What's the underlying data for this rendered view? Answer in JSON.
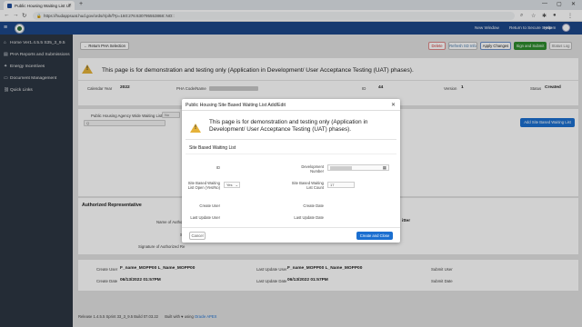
{
  "browser": {
    "tab_title": "Public Housing Waiting List Ut",
    "new_tab": "+",
    "url": "https://hudappsuat.hud.gov/ords/r/pih/f?p=160:276:630795553868::NO::",
    "min": "—",
    "max": "▢",
    "close": "✕"
  },
  "header": {
    "links": {
      "new_window": "New Window",
      "return": "Return to Secure System",
      "help": "Help"
    }
  },
  "sidebar": {
    "items": [
      {
        "icon": "home-icon",
        "glyph": "⌂",
        "label": "Home Ver1.4.5.5 S35_3_9.5"
      },
      {
        "icon": "document-icon",
        "glyph": "▤",
        "label": "PHA Reports and Submissions"
      },
      {
        "icon": "bolt-icon",
        "glyph": "✦",
        "label": "Energy Incentives"
      },
      {
        "icon": "folder-icon",
        "glyph": "▭",
        "label": "Document Management"
      },
      {
        "icon": "link-icon",
        "glyph": "⛓",
        "label": "Quick Links"
      }
    ]
  },
  "toolbar": {
    "return_label": "Return PHA Selection",
    "delete": "Delete",
    "refresh": "Refresh SD Info",
    "apply": "Apply Changes",
    "sign": "Sign and Submit",
    "status_log": "Status Log"
  },
  "banner": {
    "text": "This page is for demonstration and testing only (Application in Development/ User Acceptance Testing (UAT) phases)."
  },
  "info_row": {
    "cal_year_label": "Calendar Year",
    "cal_year": "2022",
    "pha_label": "PHA Code/Name",
    "id_label": "ID",
    "id": "44",
    "version_label": "Version",
    "version": "1",
    "status_label": "Status",
    "status": "Created"
  },
  "waitlist": {
    "agency_label": "Public Housing Agency Wide Waiting List",
    "agency_value": "No",
    "add_site": "Add Site Based Waiting List",
    "search_placeholder": "Q"
  },
  "authorized": {
    "title": "Authorized Representative",
    "name_label": "Name of Autho",
    "sig_label": "Signature of Authorized Re",
    "s_label": "S",
    "right_partial": "itter"
  },
  "audit": {
    "create_user_label": "Create User",
    "create_user": "F_name_MOPP00 L_Name_MOPP00",
    "last_user_label": "Last Update User",
    "last_user": "F_name_MOPP00 L_Name_MOPP00",
    "submit_user_label": "Submit User",
    "create_date_label": "Create Date",
    "create_date": "06/13/2022 01:57PM",
    "last_date_label": "Last Update Date",
    "last_date": "06/13/2022 01:57PM",
    "submit_date_label": "Submit Date"
  },
  "footer": {
    "release": "Release 1.4.5.5 Sprint 33_3_9.5 Build 07.03.22",
    "built": "Built with",
    "heart": "♥",
    "using": "using",
    "apex": "Oracle APEX"
  },
  "modal": {
    "title": "Public Housing Site Based Waiting List Add/Edit",
    "banner": "This page is for demonstration and testing only (Application in Development/ User Acceptance Testing (UAT) phases).",
    "section": "Site Based Waiting List",
    "id_label": "ID",
    "dev_label": "Development Number",
    "open_label": "Site Based Waiting List Open (Yes/No)",
    "open_value": "Yes",
    "count_label": "Site Based Waiting List Count",
    "count_value": "17",
    "create_user_label": "Create User",
    "create_date_label": "Create Date",
    "last_user_label": "Last Update User",
    "last_date_label": "Last Update Date",
    "cancel": "Cancel",
    "create": "Create and Close"
  },
  "colors": {
    "header": "#1d4789",
    "sidebar": "#2d3642",
    "primary": "#1b6fd0",
    "warn": "#e5b23a",
    "success": "#2d8a2d"
  }
}
